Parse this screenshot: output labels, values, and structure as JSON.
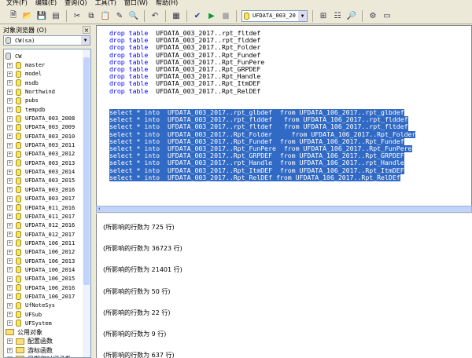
{
  "menu": [
    "文件(F)",
    "编辑(E)",
    "查询(Q)",
    "工具(T)",
    "窗口(W)",
    "帮助(H)"
  ],
  "toolbar": {
    "database": "UFDATA_003_20"
  },
  "object_browser": {
    "title": "对象浏览器 (O)",
    "close": "×",
    "server": "CW(sa)",
    "root": "CW",
    "databases": [
      "master",
      "model",
      "msdb",
      "Northwind",
      "pubs",
      "tempdb",
      "UFDATA_003_2008",
      "UFDATA_003_2009",
      "UFDATA_003_2010",
      "UFDATA_003_2011",
      "UFDATA_003_2012",
      "UFDATA_003_2013",
      "UFDATA_003_2014",
      "UFDATA_003_2015",
      "UFDATA_003_2016",
      "UFDATA_003_2017",
      "UFDATA_011_2016",
      "UFDATA_011_2017",
      "UFDATA_012_2016",
      "UFDATA_012_2017",
      "UFDATA_106_2011",
      "UFDATA_106_2012",
      "UFDATA_106_2013",
      "UFDATA_106_2014",
      "UFDATA_106_2015",
      "UFDATA_106_2016",
      "UFDATA_106_2017",
      "UfNoteSys",
      "UFSub",
      "UFSystem"
    ],
    "common": "公用对象",
    "common_children": [
      "配置函数",
      "游标函数",
      "日期和时间函数"
    ]
  },
  "editor": {
    "drop_lines": [
      "drop table  UFDATA_003_2017..rpt_fltdef",
      "drop table  UFDATA_003_2017..rpt_flddef",
      "drop table  UFDATA_003_2017..Rpt_Folder",
      "drop table  UFDATA_003_2017..Rpt_Fundef",
      "drop table  UFDATA_003_2017..Rpt_FunPere",
      "drop table  UFDATA_003_2017..Rpt_GRPDEF",
      "drop table  UFDATA_003_2017..Rpt_Handle",
      "drop table  UFDATA_003_2017..Rpt_ItmDEF",
      "drop table  UFDATA_003_2017..Rpt_RelDEf"
    ],
    "select_lines": [
      "select * into  UFDATA_003_2017..rpt_glbdef  from UFDATA_106_2017..rpt_glbdef",
      "select * into  UFDATA_003_2017..rpt_flddef   from UFDATA_106_2017..rpt_flddef",
      "select * into  UFDATA_003_2017..rpt_fltdef   from UFDATA_106_2017..rpt_fltdef",
      "select * into  UFDATA_003_2017..Rpt_Folder     from UFDATA_106_2017..Rpt_Folder",
      "select * into  UFDATA_003_2017..Rpt_Fundef  from UFDATA_106_2017..Rpt_Fundef",
      "select * into  UFDATA_003_2017..Rpt_FunPere  from UFDATA_106_2017..Rpt_FunPere",
      "select * into  UFDATA_003_2017..Rpt_GRPDEF  from UFDATA_106_2017..Rpt_GRPDEF",
      "select * into  UFDATA_003_2017..rpt_Handle  from UFDATA_106_2017..rpt_Handle",
      "select * into  UFDATA_003_2017..Rpt_ItmDEF  from UFDATA_106_2017..Rpt_ItmDEF",
      "select * into  UFDATA_003_2017..Rpt_RelDEf from UFDATA_106_2017..Rpt_RelDEf"
    ]
  },
  "results": [
    "(所影响的行数为 725 行)",
    "(所影响的行数为 36723 行)",
    "(所影响的行数为 21401 行)",
    "(所影响的行数为 50 行)",
    "(所影响的行数为 22 行)",
    "(所影响的行数为 9 行)",
    "(所影响的行数为 637 行)"
  ]
}
